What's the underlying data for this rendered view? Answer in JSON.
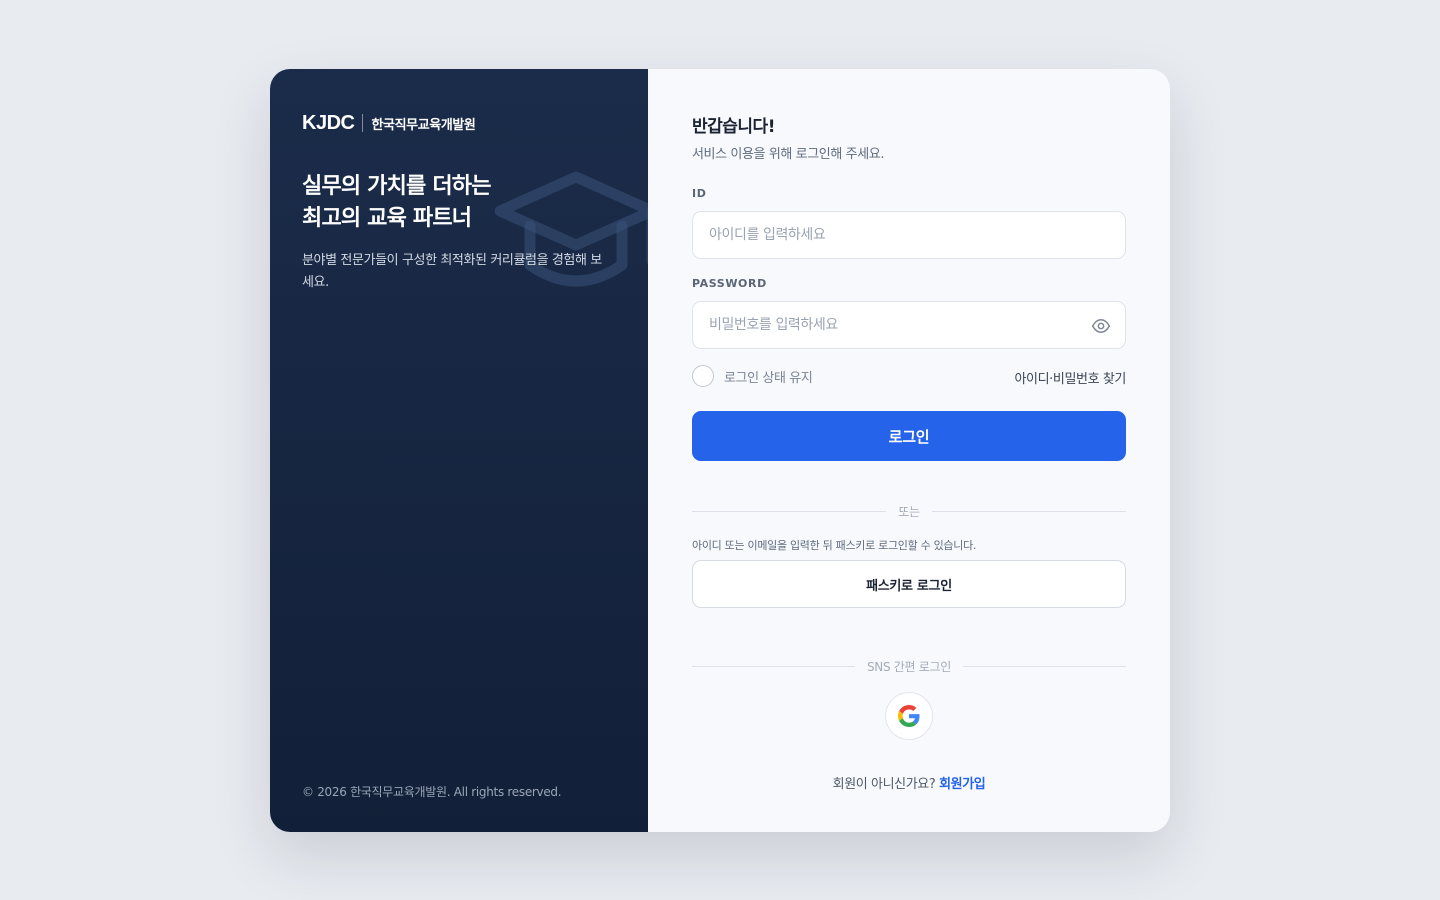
{
  "brand": {
    "logo": "KJDC",
    "name": "한국직무교육개발원",
    "headline_line1": "실무의 가치를 더하는",
    "headline_line2": "최고의 교육 파트너",
    "subcopy": "분야별 전문가들이 구성한 최적화된 커리큘럼을 경험해 보세요.",
    "copyright": "© 2026 한국직무교육개발원. All rights reserved.",
    "icon": "graduation-cap-icon"
  },
  "login": {
    "title": "반갑습니다!",
    "subtitle": "서비스 이용을 위해 로그인해 주세요.",
    "id_label": "ID",
    "id_value": "",
    "id_placeholder": "아이디를 입력하세요",
    "password_label": "PASSWORD",
    "password_value": "",
    "password_placeholder": "비밀번호를 입력하세요",
    "password_toggle_icon": "eye-icon",
    "remember_label": "로그인 상태 유지",
    "remember_checked": false,
    "find_link": "아이디·비밀번호 찾기",
    "submit_label": "로그인"
  },
  "passkey": {
    "divider": "또는",
    "hint": "아이디 또는 이메일을 입력한 뒤 패스키로 로그인할 수 있습니다.",
    "button_label": "패스키로 로그인"
  },
  "sns": {
    "divider": "SNS 간편 로그인",
    "providers": [
      {
        "name": "google",
        "icon": "google-icon"
      }
    ]
  },
  "signup": {
    "prompt": "회원이 아니신가요?",
    "link": "회원가입"
  },
  "colors": {
    "accent": "#2563eb",
    "panel_dark": "#1b2c4a",
    "page_bg": "#e8ebf0"
  }
}
